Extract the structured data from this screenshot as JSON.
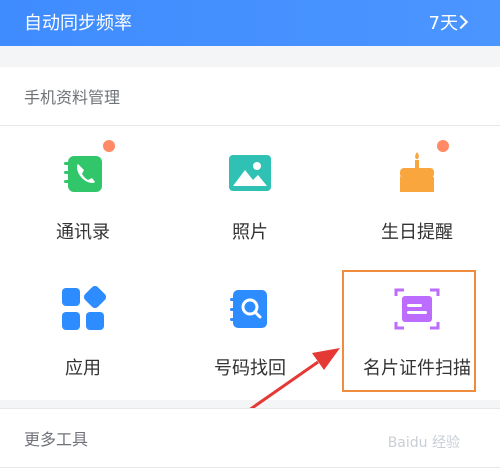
{
  "top_bar": {
    "title": "自动同步频率",
    "value": "7天"
  },
  "sections": {
    "phone_data": {
      "title": "手机资料管理"
    },
    "more_tools": {
      "title": "更多工具"
    }
  },
  "tiles": [
    {
      "label": "通讯录",
      "icon": "contacts-icon",
      "badge": true
    },
    {
      "label": "照片",
      "icon": "photos-icon",
      "badge": false
    },
    {
      "label": "生日提醒",
      "icon": "birthday-cake-icon",
      "badge": true
    },
    {
      "label": "应用",
      "icon": "apps-icon",
      "badge": false
    },
    {
      "label": "号码找回",
      "icon": "number-recovery-icon",
      "badge": false
    },
    {
      "label": "名片证件扫描",
      "icon": "business-card-scan-icon",
      "badge": false
    }
  ],
  "watermark": "Baidu 经验",
  "colors": {
    "top_bar": "#3f8cff",
    "green": "#32c66b",
    "teal": "#2fc2b4",
    "orange": "#f8a63d",
    "blue": "#2d8cff",
    "purple": "#bc6cff",
    "badge": "#ff8a65",
    "highlight": "#f08c3e",
    "annotation_arrow": "#e53935"
  }
}
